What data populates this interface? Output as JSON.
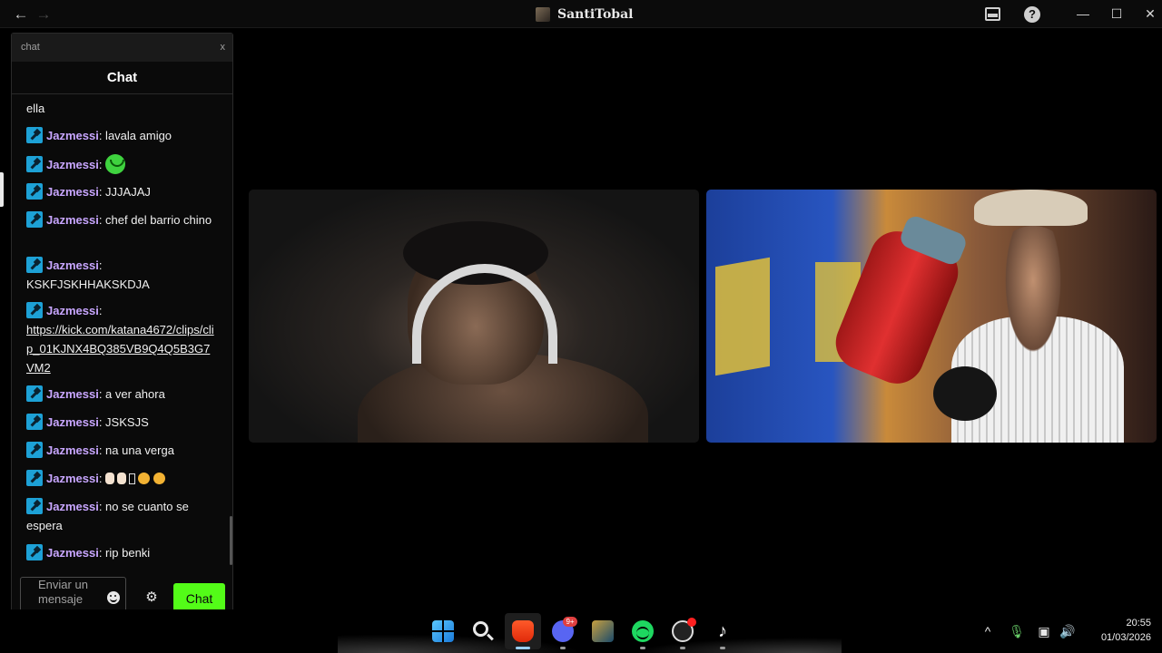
{
  "window": {
    "title": "SantiTobal",
    "back_icon": "arrow-left-icon",
    "forward_icon": "arrow-right-icon",
    "minimize_label": "—",
    "maximize_label": "☐",
    "close_label": "✕",
    "help_label": "?"
  },
  "chat": {
    "tab_label": "chat",
    "tab_close": "x",
    "header": "Chat",
    "messages": [
      {
        "user": "",
        "text": "ella"
      },
      {
        "user": "Jazmessi",
        "text": ": lavala amigo"
      },
      {
        "user": "Jazmessi",
        "text": ": "
      },
      {
        "user": "Jazmessi",
        "text": ": JJJAJAJ"
      },
      {
        "user": "Jazmessi",
        "text": ": chef del barrio chino"
      },
      {
        "user": "Jazmessi",
        "text": ": KSKFJSKHHAKSKDJA"
      },
      {
        "user": "Jazmessi",
        "text": ":",
        "link": "https://kick.com/katana4672/clips/clip_01KJNX4BQ385VB9Q4Q5B3G7VM2"
      },
      {
        "user": "Jazmessi",
        "text": ": a ver ahora"
      },
      {
        "user": "Jazmessi",
        "text": ": JSKSJS"
      },
      {
        "user": "Jazmessi",
        "text": ": na una verga"
      },
      {
        "user": "Jazmessi",
        "text": ": "
      },
      {
        "user": "Jazmessi",
        "text": ": no se cuanto se espera"
      },
      {
        "user": "Jazmessi",
        "text": ": rip benki"
      }
    ],
    "input_placeholder": "Enviar un mensaje",
    "send_label": "Chat",
    "accent_color": "#53fc18",
    "username_color": "#c8a6ff"
  },
  "taskbar": {
    "apps": [
      "windows-start-icon",
      "search-icon",
      "brave-browser-icon",
      "discord-icon",
      "league-of-legends-icon",
      "spotify-icon",
      "obs-icon",
      "tiktok-icon"
    ],
    "discord_badge": "9+",
    "tiktok_glyph": "♪",
    "tray_chevron": "^",
    "tray_mic": "🎙",
    "tray_network": "▣",
    "tray_volume": "🔊",
    "time": "20:55",
    "date": "01/03/2026"
  }
}
